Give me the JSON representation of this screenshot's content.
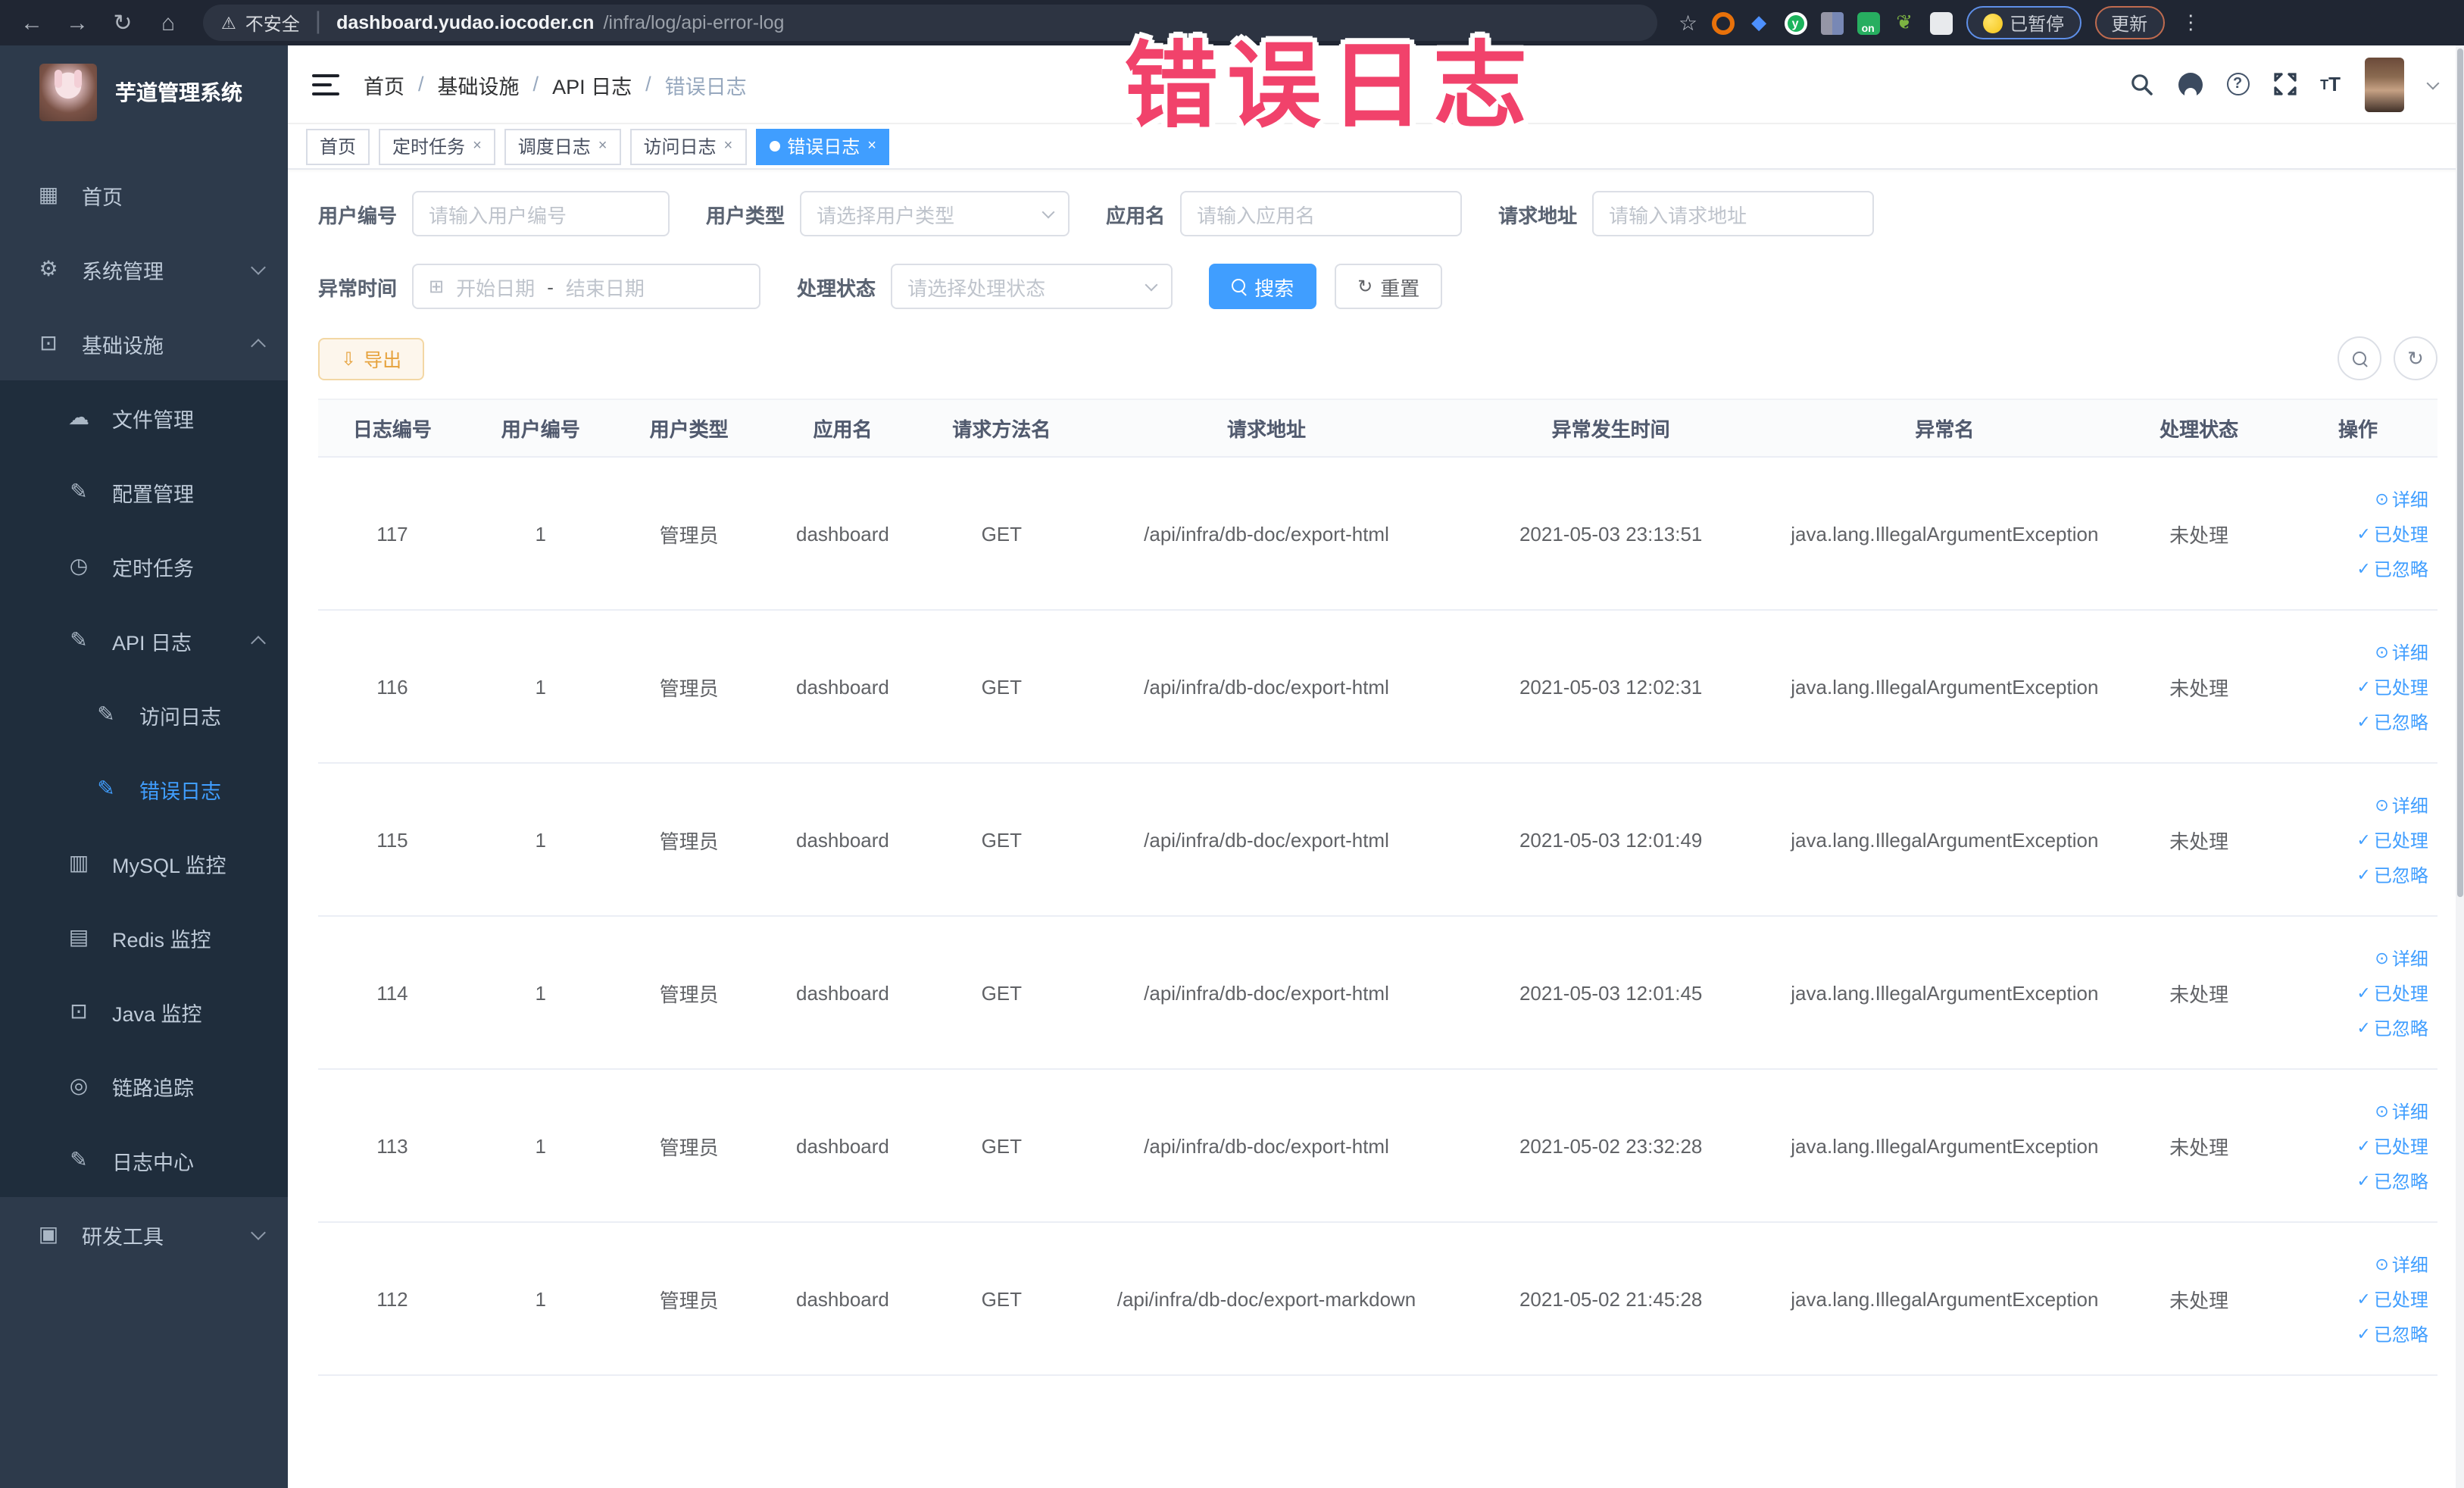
{
  "browser": {
    "security_label": "不安全",
    "url_host": "dashboard.yudao.iocoder.cn",
    "url_path": "/infra/log/api-error-log",
    "paused_label": "已暂停",
    "update_label": "更新",
    "on_badge": "on"
  },
  "sidebar": {
    "title": "芋道管理系统",
    "items": [
      {
        "label": "首页",
        "icon": "dashboard-icon",
        "level": 1,
        "arrow": "",
        "active": false
      },
      {
        "label": "系统管理",
        "icon": "gear-icon",
        "level": 1,
        "arrow": "down",
        "active": false
      },
      {
        "label": "基础设施",
        "icon": "monitor-icon",
        "level": 1,
        "arrow": "up",
        "active": false
      },
      {
        "label": "文件管理",
        "icon": "cloud-upload-icon",
        "level": 2,
        "arrow": "",
        "active": false
      },
      {
        "label": "配置管理",
        "icon": "edit-icon",
        "level": 2,
        "arrow": "",
        "active": false
      },
      {
        "label": "定时任务",
        "icon": "timer-icon",
        "level": 2,
        "arrow": "",
        "active": false
      },
      {
        "label": "API 日志",
        "icon": "log-icon",
        "level": 2,
        "arrow": "up",
        "active": false
      },
      {
        "label": "访问日志",
        "icon": "log-icon",
        "level": 3,
        "arrow": "",
        "active": false
      },
      {
        "label": "错误日志",
        "icon": "log-icon",
        "level": 3,
        "arrow": "",
        "active": true
      },
      {
        "label": "MySQL 监控",
        "icon": "chart-icon",
        "level": 2,
        "arrow": "",
        "active": false
      },
      {
        "label": "Redis 监控",
        "icon": "layers-icon",
        "level": 2,
        "arrow": "",
        "active": false
      },
      {
        "label": "Java 监控",
        "icon": "java-monitor-icon",
        "level": 2,
        "arrow": "",
        "active": false
      },
      {
        "label": "链路追踪",
        "icon": "eye-icon",
        "level": 2,
        "arrow": "",
        "active": false
      },
      {
        "label": "日志中心",
        "icon": "log-icon",
        "level": 2,
        "arrow": "",
        "active": false
      },
      {
        "label": "研发工具",
        "icon": "toolbox-icon",
        "level": 1,
        "arrow": "down",
        "active": false
      }
    ],
    "icon_glyphs": {
      "dashboard-icon": "▦",
      "gear-icon": "⚙",
      "monitor-icon": "⊡",
      "cloud-upload-icon": "☁",
      "edit-icon": "✎",
      "timer-icon": "◷",
      "log-icon": "✎",
      "chart-icon": "▥",
      "layers-icon": "▤",
      "java-monitor-icon": "⊡",
      "eye-icon": "◎",
      "toolbox-icon": "▣"
    }
  },
  "breadcrumb": [
    "首页",
    "基础设施",
    "API 日志",
    "错误日志"
  ],
  "tabs": [
    {
      "label": "首页",
      "closable": false,
      "active": false
    },
    {
      "label": "定时任务",
      "closable": true,
      "active": false
    },
    {
      "label": "调度日志",
      "closable": true,
      "active": false
    },
    {
      "label": "访问日志",
      "closable": true,
      "active": false
    },
    {
      "label": "错误日志",
      "closable": true,
      "active": true
    }
  ],
  "filters": {
    "user_id": {
      "label": "用户编号",
      "placeholder": "请输入用户编号"
    },
    "user_type": {
      "label": "用户类型",
      "placeholder": "请选择用户类型"
    },
    "app_name": {
      "label": "应用名",
      "placeholder": "请输入应用名"
    },
    "request_url": {
      "label": "请求地址",
      "placeholder": "请输入请求地址"
    },
    "error_time": {
      "label": "异常时间",
      "start_placeholder": "开始日期",
      "separator": "-",
      "end_placeholder": "结束日期"
    },
    "process_status": {
      "label": "处理状态",
      "placeholder": "请选择处理状态"
    },
    "search_label": "搜索",
    "reset_label": "重置"
  },
  "toolbar": {
    "export_label": "导出"
  },
  "table": {
    "columns": [
      "日志编号",
      "用户编号",
      "用户类型",
      "应用名",
      "请求方法名",
      "请求地址",
      "异常发生时间",
      "异常名",
      "处理状态",
      "操作"
    ],
    "row_actions": [
      {
        "label": "详细",
        "icon": "eye-icon"
      },
      {
        "label": "已处理",
        "icon": "check-icon"
      },
      {
        "label": "已忽略",
        "icon": "check-icon"
      }
    ],
    "rows": [
      {
        "log_id": "117",
        "user_id": "1",
        "user_type": "管理员",
        "app_name": "dashboard",
        "method": "GET",
        "url": "/api/infra/db-doc/export-html",
        "time": "2021-05-03 23:13:51",
        "exception": "java.lang.IllegalArgumentException",
        "status": "未处理"
      },
      {
        "log_id": "116",
        "user_id": "1",
        "user_type": "管理员",
        "app_name": "dashboard",
        "method": "GET",
        "url": "/api/infra/db-doc/export-html",
        "time": "2021-05-03 12:02:31",
        "exception": "java.lang.IllegalArgumentException",
        "status": "未处理"
      },
      {
        "log_id": "115",
        "user_id": "1",
        "user_type": "管理员",
        "app_name": "dashboard",
        "method": "GET",
        "url": "/api/infra/db-doc/export-html",
        "time": "2021-05-03 12:01:49",
        "exception": "java.lang.IllegalArgumentException",
        "status": "未处理"
      },
      {
        "log_id": "114",
        "user_id": "1",
        "user_type": "管理员",
        "app_name": "dashboard",
        "method": "GET",
        "url": "/api/infra/db-doc/export-html",
        "time": "2021-05-03 12:01:45",
        "exception": "java.lang.IllegalArgumentException",
        "status": "未处理"
      },
      {
        "log_id": "113",
        "user_id": "1",
        "user_type": "管理员",
        "app_name": "dashboard",
        "method": "GET",
        "url": "/api/infra/db-doc/export-html",
        "time": "2021-05-02 23:32:28",
        "exception": "java.lang.IllegalArgumentException",
        "status": "未处理"
      },
      {
        "log_id": "112",
        "user_id": "1",
        "user_type": "管理员",
        "app_name": "dashboard",
        "method": "GET",
        "url": "/api/infra/db-doc/export-markdown",
        "time": "2021-05-02 21:45:28",
        "exception": "java.lang.IllegalArgumentException",
        "status": "未处理"
      }
    ]
  },
  "annotation": {
    "text": "错误日志"
  },
  "colors": {
    "accent": "#409eff",
    "warning": "#e6a23c",
    "annotation_pink": "#f1426b",
    "sidebar_bg": "#2d3a4b",
    "submenu_bg": "#1f2d3c",
    "topbar_bg": "#202633"
  }
}
